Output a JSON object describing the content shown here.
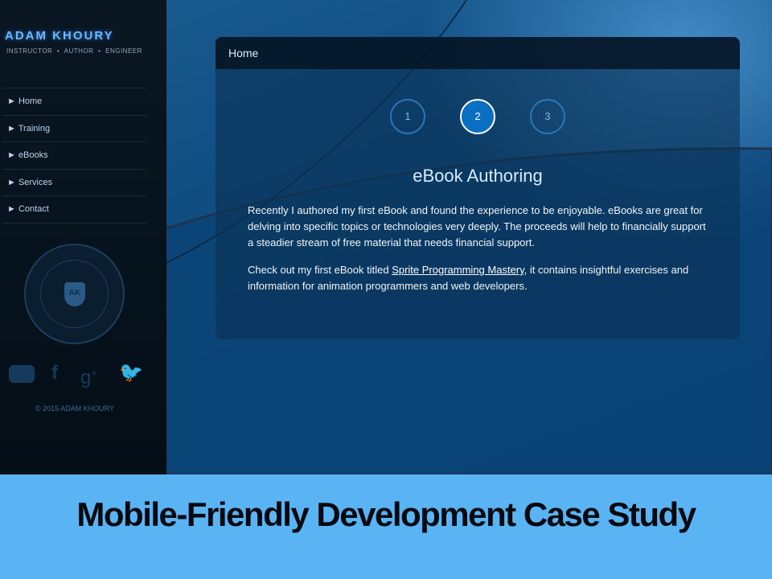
{
  "sidebar": {
    "logo": "ADAM KHOURY",
    "tagline": "INSTRUCTOR  •  AUTHOR  •  ENGINEER",
    "nav": [
      "► Home",
      "► Training",
      "► eBooks",
      "► Services",
      "► Contact"
    ],
    "seal_text": "AK",
    "copyright": "© 2015 ADAM KHOURY",
    "social": [
      "youtube-icon",
      "facebook-icon",
      "google-plus-icon",
      "twitter-icon"
    ]
  },
  "panel": {
    "header": "Home",
    "slides": [
      "1",
      "2",
      "3"
    ],
    "active_slide": "2",
    "title": "eBook Authoring",
    "para1": "Recently I authored my first eBook and found the experience to be enjoyable. eBooks are great for delving into specific topics or technologies very deeply. The proceeds will help to financially support a steadier stream of free material that needs financial support.",
    "para2_pre": "Check out my first eBook titled ",
    "para2_link": "Sprite Programming Mastery",
    "para2_post": ", it contains insightful exercises and information for animation programmers and web developers."
  },
  "banner": "Mobile-Friendly Development Case Study"
}
